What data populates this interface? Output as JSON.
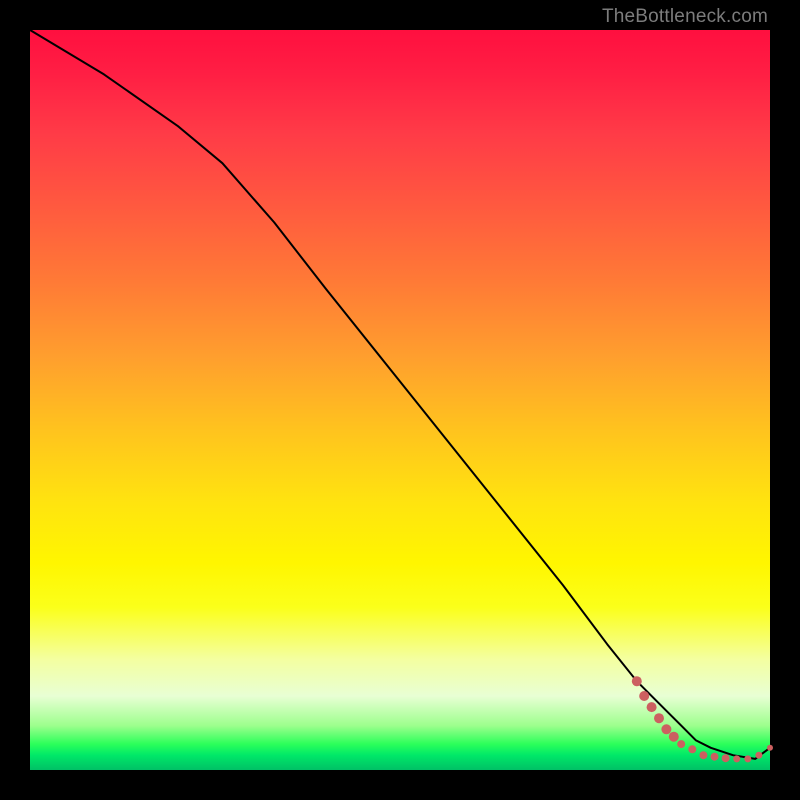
{
  "watermark": "TheBottleneck.com",
  "chart_data": {
    "type": "line",
    "title": "",
    "xlabel": "",
    "ylabel": "",
    "xlim": [
      0,
      100
    ],
    "ylim": [
      0,
      100
    ],
    "series": [
      {
        "name": "curve",
        "x": [
          0,
          10,
          20,
          26,
          33,
          40,
          48,
          56,
          64,
          72,
          78,
          82,
          86,
          88,
          90,
          92,
          95,
          98,
          100
        ],
        "y": [
          100,
          94,
          87,
          82,
          74,
          65,
          55,
          45,
          35,
          25,
          17,
          12,
          8,
          6,
          4,
          3,
          2,
          1.5,
          3
        ]
      }
    ],
    "markers": {
      "name": "tail-dots",
      "color": "#cc6060",
      "points": [
        {
          "x": 82,
          "y": 12,
          "r": 5
        },
        {
          "x": 83,
          "y": 10,
          "r": 5
        },
        {
          "x": 84,
          "y": 8.5,
          "r": 5
        },
        {
          "x": 85,
          "y": 7,
          "r": 5
        },
        {
          "x": 86,
          "y": 5.5,
          "r": 5
        },
        {
          "x": 87,
          "y": 4.5,
          "r": 5
        },
        {
          "x": 88,
          "y": 3.5,
          "r": 4
        },
        {
          "x": 89.5,
          "y": 2.8,
          "r": 4
        },
        {
          "x": 91,
          "y": 2,
          "r": 4
        },
        {
          "x": 92.5,
          "y": 1.8,
          "r": 4
        },
        {
          "x": 94,
          "y": 1.6,
          "r": 4
        },
        {
          "x": 95.5,
          "y": 1.5,
          "r": 3.5
        },
        {
          "x": 97,
          "y": 1.5,
          "r": 3.5
        },
        {
          "x": 98.5,
          "y": 2,
          "r": 3.5
        },
        {
          "x": 100,
          "y": 3,
          "r": 3
        }
      ]
    }
  }
}
